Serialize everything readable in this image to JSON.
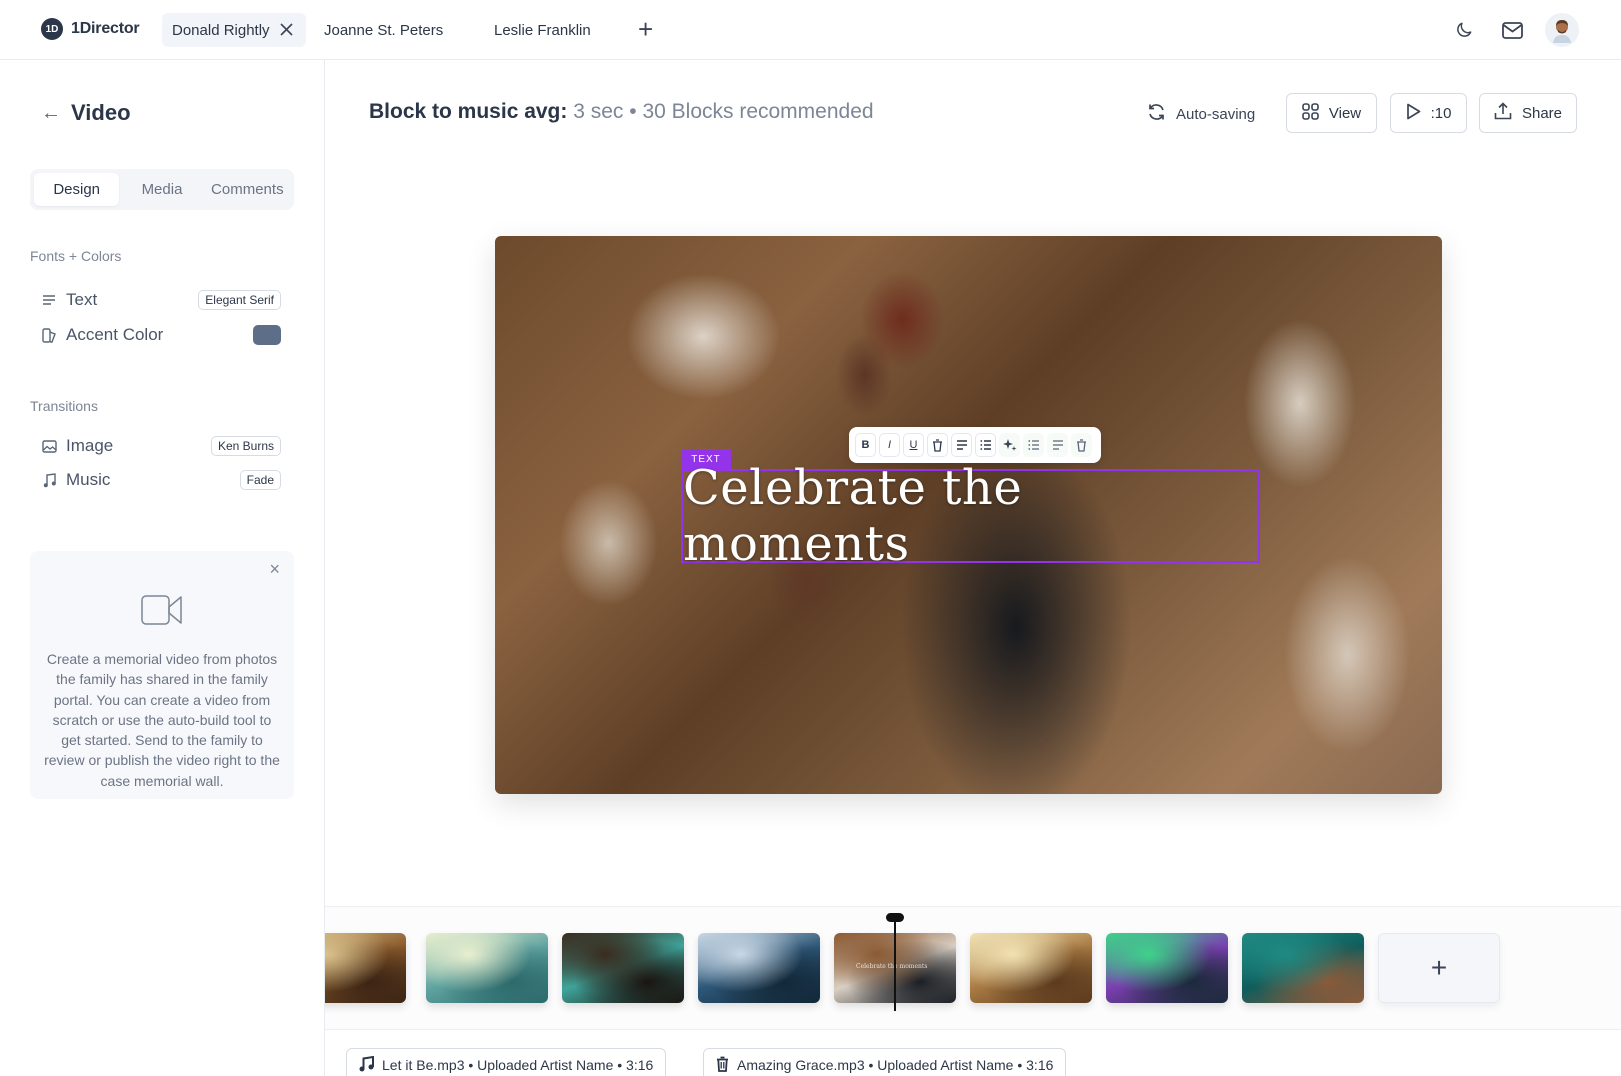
{
  "app": {
    "name": "1Director",
    "logo_glyph": "1D"
  },
  "tabs": [
    {
      "label": "Donald Rightly",
      "active": true,
      "closable": true
    },
    {
      "label": "Joanne St. Peters",
      "active": false
    },
    {
      "label": "Leslie Franklin",
      "active": false
    }
  ],
  "top_icons": {
    "add_tab": "+",
    "theme": "moon-icon",
    "mail": "mail-icon",
    "avatar": "user-avatar"
  },
  "sidebar": {
    "back_icon": "←",
    "title": "Video",
    "segments": [
      {
        "label": "Design",
        "active": true
      },
      {
        "label": "Media",
        "active": false
      },
      {
        "label": "Comments",
        "active": false
      }
    ],
    "fonts_colors": {
      "heading": "Fonts + Colors",
      "items": [
        {
          "icon": "text-align-icon",
          "label": "Text",
          "value": "Elegant Serif"
        },
        {
          "icon": "palette-icon",
          "label": "Accent Color",
          "value_color": "#5e6e88"
        }
      ]
    },
    "transitions": {
      "heading": "Transitions",
      "items": [
        {
          "icon": "image-icon",
          "label": "Image",
          "value": "Ken Burns"
        },
        {
          "icon": "music-note-icon",
          "label": "Music",
          "value": "Fade"
        }
      ]
    },
    "info_card": {
      "close": "×",
      "icon": "video-camera-icon",
      "text": "Create a memorial video from photos the family has shared in the family portal. You can create a video from scratch or use the auto-build tool to get started. Send to the family to review or publish the video right to the case memorial wall."
    }
  },
  "header": {
    "stat_label": "Block to music avg:",
    "stat_value": "3 sec • 30 Blocks recommended",
    "autosave_label": "Auto-saving",
    "view_label": "View",
    "play_label": ":10",
    "share_label": "Share"
  },
  "canvas": {
    "text_tag": "TEXT",
    "headline": "Celebrate the moments",
    "format_toolbar": [
      {
        "name": "bold",
        "glyph": "B"
      },
      {
        "name": "italic",
        "glyph": "I"
      },
      {
        "name": "underline",
        "glyph": "U"
      },
      {
        "name": "delete",
        "glyph": "trash"
      },
      {
        "name": "align",
        "glyph": "align"
      },
      {
        "name": "list",
        "glyph": "list"
      },
      {
        "name": "ai-sparkle",
        "glyph": "sparkle"
      },
      {
        "name": "list-2",
        "glyph": "list"
      },
      {
        "name": "align-2",
        "glyph": "align"
      },
      {
        "name": "delete-2",
        "glyph": "trash"
      }
    ]
  },
  "timeline": {
    "thumbnails": [
      {
        "name": "golden-landscape",
        "colors": [
          "#d9c18c",
          "#8a5a2b",
          "#3b2414"
        ]
      },
      {
        "name": "teal-tree",
        "colors": [
          "#e8efcf",
          "#5fa3a0",
          "#2c6a6b"
        ]
      },
      {
        "name": "dark-teal-abstract",
        "colors": [
          "#3a2c1f",
          "#3fa49a",
          "#1a1410"
        ]
      },
      {
        "name": "ocean-waves",
        "colors": [
          "#c8d8e6",
          "#2d5677",
          "#122838"
        ]
      },
      {
        "name": "celebrate-photo",
        "colors": [
          "#8b5a33",
          "#d9cfc3",
          "#1b1f25"
        ],
        "caption": "Celebrate the moments",
        "selected": true
      },
      {
        "name": "cream-gold",
        "colors": [
          "#f1e2b3",
          "#a87a43",
          "#5b3a1d"
        ]
      },
      {
        "name": "green-purple-abstract",
        "colors": [
          "#3ed28a",
          "#7a3fb0",
          "#1b2a3a"
        ]
      },
      {
        "name": "teal-swirl",
        "colors": [
          "#1f8a82",
          "#0f5d5c",
          "#8a5a3a"
        ]
      }
    ],
    "add_label": "+"
  },
  "audio_tracks": [
    {
      "icon": "music-note-icon",
      "label": "Let it Be.mp3 •  Uploaded Artist Name • 3:16"
    },
    {
      "icon": "trash-icon",
      "label": "Amazing Grace.mp3 •  Uploaded Artist Name • 3:16"
    }
  ],
  "colors": {
    "accent_purple": "#9333ea",
    "text_dark": "#2b3648",
    "text_muted": "#7d8696"
  }
}
